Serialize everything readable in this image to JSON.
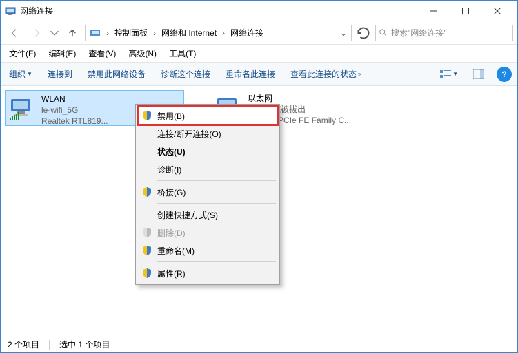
{
  "window": {
    "title": "网络连接"
  },
  "path": {
    "seg1": "控制面板",
    "seg2": "网络和 Internet",
    "seg3": "网络连接"
  },
  "search": {
    "placeholder": "搜索\"网络连接\""
  },
  "menus": {
    "file": "文件(F)",
    "edit": "编辑(E)",
    "view": "查看(V)",
    "advanced": "高级(N)",
    "tools": "工具(T)"
  },
  "toolbar": {
    "organize": "组织",
    "connect": "连接到",
    "disable": "禁用此网络设备",
    "diagnose": "诊断这个连接",
    "rename": "重命名此连接",
    "status": "查看此连接的状态"
  },
  "adapters": {
    "wlan": {
      "name": "WLAN",
      "ssid": "le-wifi_5G",
      "device": "Realtek RTL819..."
    },
    "eth": {
      "name": "以太网",
      "status": "网络电缆被拔出",
      "device": "Realtek PCIe FE Family C..."
    }
  },
  "context": {
    "disable": "禁用(B)",
    "connect": "连接/断开连接(O)",
    "status": "状态(U)",
    "diagnose": "诊断(I)",
    "bridge": "桥接(G)",
    "shortcut": "创建快捷方式(S)",
    "delete": "删除(D)",
    "rename": "重命名(M)",
    "properties": "属性(R)"
  },
  "statusbar": {
    "count": "2 个项目",
    "selected": "选中 1 个项目"
  }
}
